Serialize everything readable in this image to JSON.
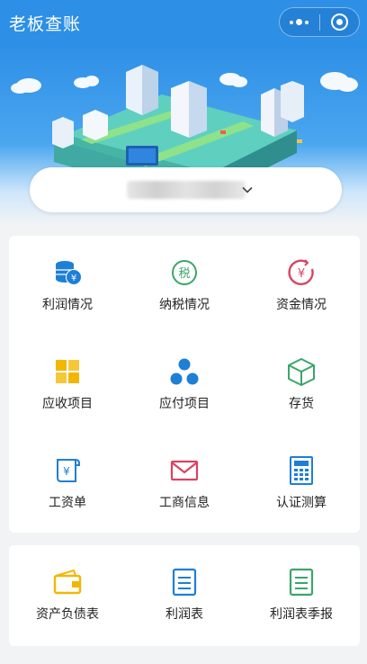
{
  "header": {
    "title": "老板查账"
  },
  "company_selector": {
    "name_hidden": true
  },
  "main_menu": [
    {
      "label": "利润情况",
      "icon": "coins-yen-icon",
      "color": "#1e7fd6"
    },
    {
      "label": "纳税情况",
      "icon": "tax-icon",
      "color": "#3aa66a"
    },
    {
      "label": "资金情况",
      "icon": "yen-circle-icon",
      "color": "#d94364"
    },
    {
      "label": "应收项目",
      "icon": "grid-blocks-icon",
      "color": "#f2b705"
    },
    {
      "label": "应付项目",
      "icon": "org-chart-icon",
      "color": "#1e7fd6"
    },
    {
      "label": "存货",
      "icon": "box-icon",
      "color": "#3aa66a"
    },
    {
      "label": "工资单",
      "icon": "scroll-yen-icon",
      "color": "#1e7fd6"
    },
    {
      "label": "工商信息",
      "icon": "envelope-icon",
      "color": "#d94364"
    },
    {
      "label": "认证测算",
      "icon": "calculator-icon",
      "color": "#1e7fd6"
    }
  ],
  "reports_menu": [
    {
      "label": "资产负债表",
      "icon": "wallet-icon",
      "color": "#f2b705"
    },
    {
      "label": "利润表",
      "icon": "report-list-icon",
      "color": "#1e7fd6"
    },
    {
      "label": "利润表季报",
      "icon": "report-list-icon",
      "color": "#3aa66a"
    }
  ]
}
